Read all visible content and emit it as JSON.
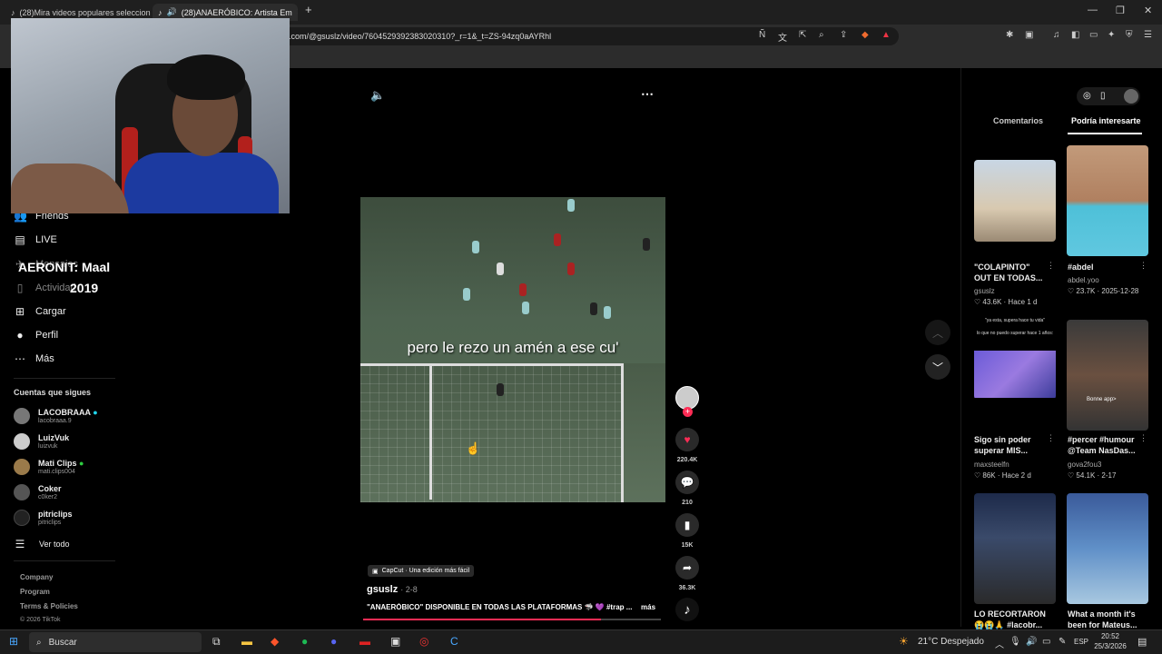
{
  "browser": {
    "tabs": [
      {
        "title": "(28)Mira videos populares seleccion"
      },
      {
        "title": "(28)ANAERÓBICO: Artista Em"
      }
    ],
    "new_tab": "+",
    "url": ".com/@gsuslz/video/7604529392383020310?_r=1&_t=ZS-94zq0aAYRhl",
    "window_controls": [
      "—",
      "❐",
      "✕"
    ]
  },
  "overlay": {
    "line1": "AERONIT: Maal",
    "line2": "2019"
  },
  "sidebar": {
    "nav": [
      {
        "label": "Friends",
        "icon": "friends-icon"
      },
      {
        "label": "LIVE",
        "icon": "live-icon"
      },
      {
        "label": "Mensajes",
        "icon": "messages-icon"
      },
      {
        "label": "Actividad",
        "icon": "activity-icon"
      },
      {
        "label": "Cargar",
        "icon": "upload-icon"
      },
      {
        "label": "Perfil",
        "icon": "profile-icon"
      },
      {
        "label": "Más",
        "icon": "more-icon"
      }
    ],
    "following_title": "Cuentas que sigues",
    "accounts": [
      {
        "name": "LACOBRAAA",
        "handle": "lacobraaa.9"
      },
      {
        "name": "LuizVuk",
        "handle": "luizvuk"
      },
      {
        "name": "Mati Clips",
        "handle": "mati.clips004"
      },
      {
        "name": "Coker",
        "handle": "c0ker2"
      },
      {
        "name": "pitriclips",
        "handle": "pitriclips"
      }
    ],
    "see_all": "Ver todo",
    "footer": [
      "Company",
      "Program",
      "Terms & Policies",
      "© 2026 TikTok"
    ]
  },
  "video": {
    "caption": "pero le rezo un amén a ese cu'",
    "capcut": "CapCut · Una edición más fácil",
    "author": "gsuslz",
    "date": "· 2-8",
    "description": "\"ANAERÓBICO\" DISPONIBLE EN TODAS LAS PLATAFORMAS 🦈 💜 #trap ...",
    "more": "más",
    "likes": "220.4K",
    "comments": "210",
    "saves": "15K",
    "shares": "36.3K"
  },
  "right_panel": {
    "tabs": [
      "Comentarios",
      "Podría interesarte"
    ],
    "cards": [
      {
        "title": "\"COLAPINTO\" OUT EN TODAS...",
        "user": "gsuslz",
        "likes": "43.6K",
        "date": "Hace 1 d"
      },
      {
        "title": "#abdel",
        "user": "abdel.yoo",
        "likes": "23.7K",
        "date": "2025-12-28"
      },
      {
        "title": "Sigo sin poder superar MIS...",
        "user": "maxsteelfn",
        "likes": "86K",
        "date": "Hace 2 d"
      },
      {
        "title": "#percer #humour @Team NasDas...",
        "user": "gova2fou3",
        "likes": "54.1K",
        "date": "2-17"
      },
      {
        "title": "LO RECORTARON 😭😭🙏 #lacobr...",
        "user": "",
        "likes": "",
        "date": ""
      },
      {
        "title": "What a month it's been for Mateus...",
        "user": "",
        "likes": "",
        "date": ""
      }
    ],
    "thumb_texts": [
      "\"ya esta, supera hace tu vida\"",
      "lo que no puedo superar hace 1 años:",
      "Bonne app>"
    ]
  },
  "taskbar": {
    "search": "Buscar",
    "weather": "21°C Despejado",
    "lang": "ESP",
    "time": "20:52",
    "date": "25/3/2026"
  }
}
